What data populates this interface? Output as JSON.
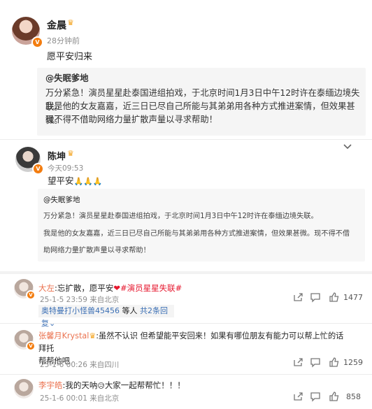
{
  "post1": {
    "author": "金晨",
    "time": "28分钟前",
    "text": "愿平安归来",
    "quote_author": "@失眠爹地",
    "quote_lines": [
      "万分紧急！演员星星赴泰国进组拍戏，于北京时间1月3日中午12时许在泰缅边境失联。",
      "我是他的女友嘉嘉，近三日已尽自己所能与其弟弟用各种方式推进案情，但效果甚微。",
      "现不得不借助网络力量扩散声量以寻求帮助！"
    ]
  },
  "post2": {
    "author": "陈坤",
    "time": "今天09:53",
    "text": "望平安",
    "emoji": "🙏🙏🙏",
    "quote_author": "@失眠爹地",
    "quote_lines": [
      "万分紧急！演员星星赴泰国进组拍戏，于北京时间1月3日中午12时许在泰缅边境失联。",
      "我是他的女友嘉嘉，近三日已尽自己所能与其弟弟用各种方式推进案情，但效果甚微。现不得不借",
      "助网络力量扩散声量以寻求帮助！"
    ]
  },
  "comments": [
    {
      "name": "大左",
      "text_before": ":忘扩散，愿平安",
      "heart": "❤",
      "topic": "#演员星星失联#",
      "meta": "25-1-5 23:59 来自北京",
      "likes": "1477",
      "reply_users": "奥特曼打小怪兽45456",
      "reply_mid": "等人",
      "reply_count": "共2条回复"
    },
    {
      "name": "张馨月Krystal",
      "line1": ":虽然不认识 但希望能平安回来！如果有哪位朋友有能力可以帮上忙的话 拜托",
      "line2": "帮帮他吧",
      "meta": "25-1-6 00:26 来自四川",
      "likes": "1259"
    },
    {
      "name": "李宇皓",
      "text_a": ":我的天呐",
      "emoji": "😥",
      "text_b": "大家一起帮帮忙！！！",
      "meta": "25-1-6 00:01 来自北京",
      "likes": "858"
    }
  ],
  "colors": {
    "accent_red": "#e6162d",
    "link_blue": "#3b6fb5",
    "name_orange": "#eb7350",
    "badge_orange": "#f37d10"
  }
}
